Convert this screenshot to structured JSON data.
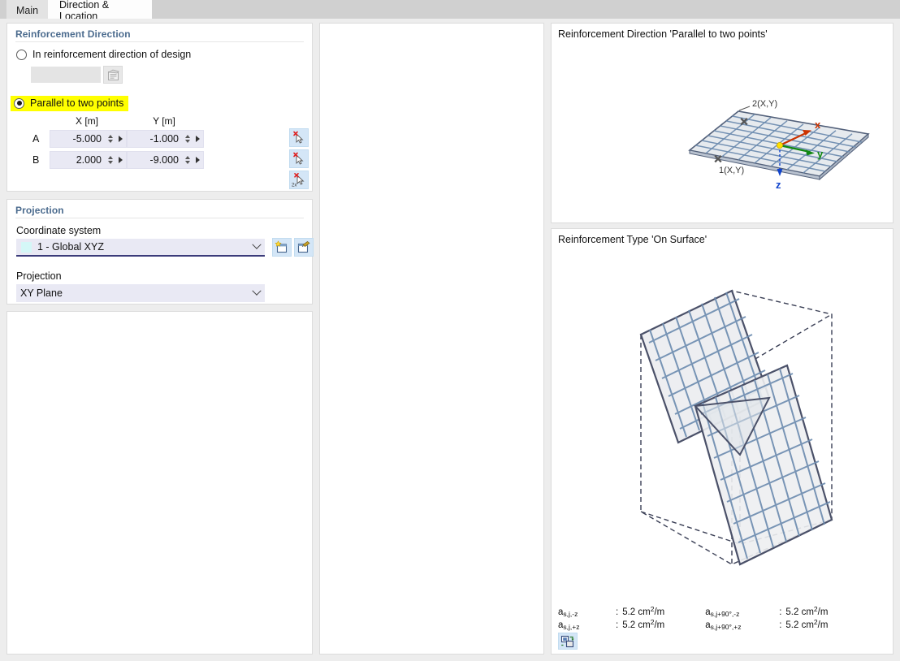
{
  "tabs": [
    {
      "label": "Main",
      "active": false
    },
    {
      "label": "Direction & Location",
      "active": true
    }
  ],
  "reinforcement_direction": {
    "section_title": "Reinforcement Direction",
    "option_design": {
      "label": "In reinforcement direction of design",
      "selected": false,
      "field_value": "",
      "field_enabled": false,
      "button_icon": "list-select-icon"
    },
    "option_parallel": {
      "label": "Parallel to two points",
      "selected": true,
      "highlight_color": "#ffff00"
    },
    "columns": [
      "X [m]",
      "Y [m]"
    ],
    "rows": [
      {
        "label": "A",
        "x": "-5.000",
        "y": "-1.000"
      },
      {
        "label": "B",
        "x": "2.000",
        "y": "-9.000"
      }
    ],
    "pick_buttons": [
      {
        "icon": "pick-point-icon",
        "label": ""
      },
      {
        "icon": "pick-point-icon",
        "label": ""
      },
      {
        "icon": "pick-2-points-icon",
        "label": "2x"
      }
    ]
  },
  "projection": {
    "section_title": "Projection",
    "coordinate_system_label": "Coordinate system",
    "coordinate_system_value": "1 - Global XYZ",
    "coordinate_system_swatch": "#d4f7f7",
    "new_button_icon": "new-coordinate-system-icon",
    "edit_button_icon": "edit-coordinate-system-icon",
    "projection_label": "Projection",
    "projection_value": "XY Plane"
  },
  "preview_top": {
    "title": "Reinforcement Direction 'Parallel to two points'",
    "point_labels": [
      "1(X,Y)",
      "2(X,Y)"
    ],
    "axis_labels": [
      "x",
      "y",
      "z"
    ],
    "axis_colors": {
      "x": "#cc3300",
      "y": "#118811",
      "z": "#1144cc"
    }
  },
  "preview_bottom": {
    "title": "Reinforcement Type 'On Surface'",
    "results": [
      [
        {
          "key_main": "a",
          "key_sub": "s,j,-z",
          "key_sup": "",
          "value": "5.2 cm",
          "value_sup": "2",
          "value_tail": "/m"
        },
        {
          "key_main": "a",
          "key_sub": "s,j+90°,-z",
          "key_sup": "",
          "value": "5.2 cm",
          "value_sup": "2",
          "value_tail": "/m"
        }
      ],
      [
        {
          "key_main": "a",
          "key_sub": "s,j,+z",
          "key_sup": "",
          "value": "5.2 cm",
          "value_sup": "2",
          "value_tail": "/m"
        },
        {
          "key_main": "a",
          "key_sub": "s,j+90°,+z",
          "key_sup": "",
          "value": "5.2 cm",
          "value_sup": "2",
          "value_tail": "/m"
        }
      ]
    ],
    "colon": ":",
    "toggle_button_icon": "toggle-graphic-icon"
  }
}
